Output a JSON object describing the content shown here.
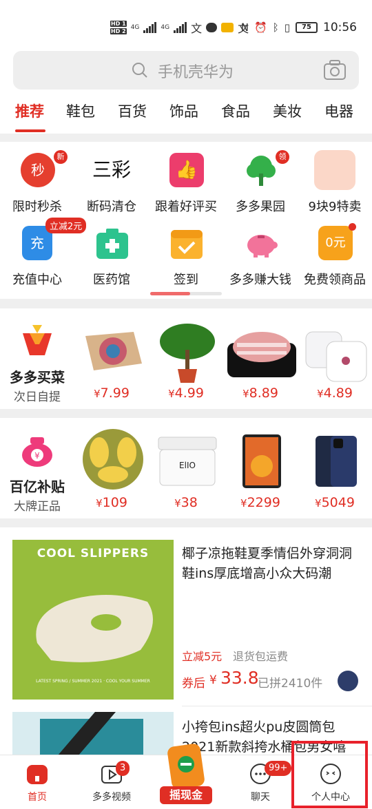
{
  "status_bar": {
    "hd1": "HD 1",
    "hd2": "HD 2",
    "net1": "4G",
    "net2": "4G",
    "battery": "75",
    "time": "10:56",
    "wen1": "文",
    "wen2": "文"
  },
  "search": {
    "placeholder": "手机壳华为"
  },
  "tabs": [
    "推荐",
    "鞋包",
    "百货",
    "饰品",
    "食品",
    "美妆",
    "电器"
  ],
  "quick_grid": {
    "items": [
      {
        "label": "限时秒杀",
        "icon": "alarm-clock-icon",
        "badge": "新",
        "glyph": "秒"
      },
      {
        "label": "断码清仓",
        "icon": "sancai-logo",
        "text": "三彩"
      },
      {
        "label": "跟着好评买",
        "icon": "thumbs-up-icon"
      },
      {
        "label": "多多果园",
        "icon": "tree-icon",
        "badge": "领"
      },
      {
        "label": "9块9特卖",
        "icon": "cartoon-face-icon"
      },
      {
        "label": "充值中心",
        "icon": "phone-recharge-icon",
        "badge": "立减2元",
        "glyph": "充"
      },
      {
        "label": "医药馆",
        "icon": "medical-kit-icon"
      },
      {
        "label": "签到",
        "icon": "calendar-check-icon"
      },
      {
        "label": "多多赚大钱",
        "icon": "piggy-bank-icon"
      },
      {
        "label": "免费领商品",
        "icon": "shopping-bag-icon",
        "glyph": "0元"
      }
    ]
  },
  "promo_vegetables": {
    "title": "多多买菜",
    "subtitle": "次日自提",
    "products": [
      {
        "name": "floral-rug",
        "price": "7.99"
      },
      {
        "name": "money-tree-plant",
        "price": "4.99"
      },
      {
        "name": "pork-belly",
        "price": "8.89"
      },
      {
        "name": "ceramic-dishes",
        "price": "4.89"
      }
    ]
  },
  "promo_subsidy": {
    "title": "百亿补贴",
    "subtitle": "大牌正品",
    "products": [
      {
        "name": "durian",
        "price": "109",
        "text": ""
      },
      {
        "name": "face-mask-jar",
        "price": "38",
        "text": "ElIO"
      },
      {
        "name": "ipad",
        "price": "2299",
        "text": ""
      },
      {
        "name": "iphone",
        "price": "5049",
        "text": ""
      }
    ]
  },
  "currency": "¥",
  "feed": [
    {
      "image_text": "COOL SLIPPERS",
      "image_subtext": "LATEST SPRING / SUMMER 2021 · COOL YOUR SUMMER",
      "title": "椰子凉拖鞋夏季情侣外穿洞洞鞋ins厚底增高小众大码潮",
      "tag_discount": "立减5元",
      "tag_return": "退货包运费",
      "coupon_label": "券后",
      "price": "33.8",
      "sold": "已拼2410件"
    },
    {
      "title": "小挎包ins超火pu皮圆筒包2021新款斜挎水桶包男女嘻"
    }
  ],
  "bottom_nav": [
    {
      "label": "首页",
      "icon": "home-icon",
      "active": true
    },
    {
      "label": "多多视频",
      "icon": "video-icon",
      "badge": "3"
    },
    {
      "label": "摇现金",
      "icon": "shake-cash-icon"
    },
    {
      "label": "聊天",
      "icon": "chat-icon",
      "badge": "99+"
    },
    {
      "label": "个人中心",
      "icon": "profile-icon"
    }
  ],
  "colors": {
    "brand": "#e02e24",
    "highlight": "#e8212b"
  }
}
